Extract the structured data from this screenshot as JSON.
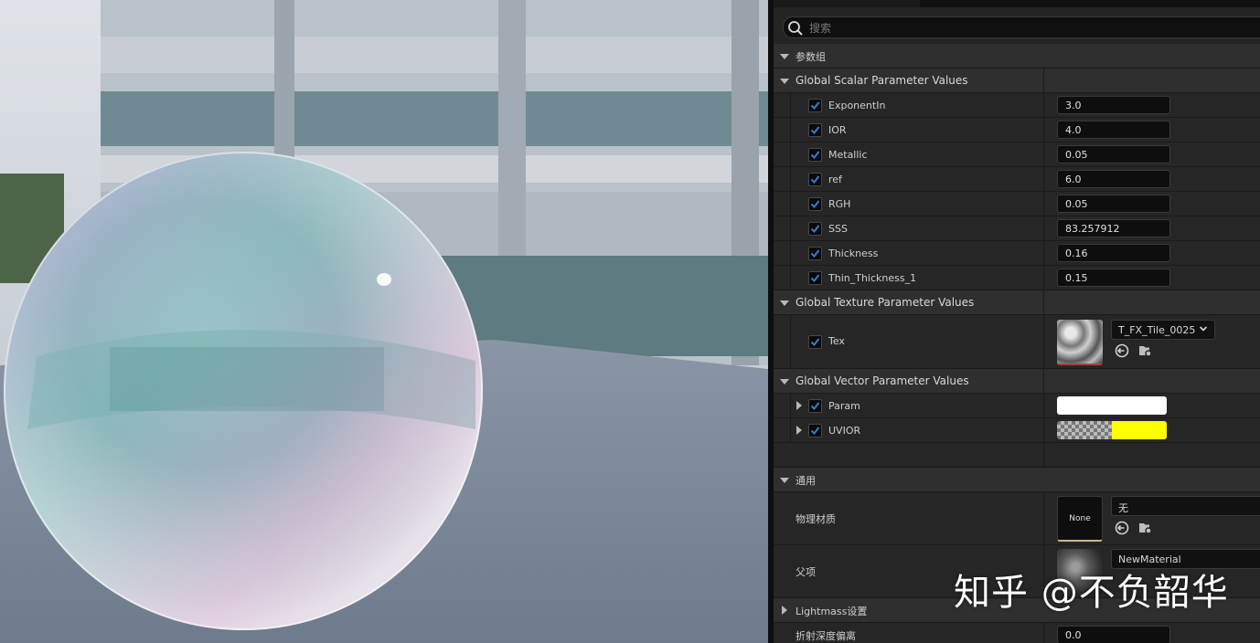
{
  "search": {
    "placeholder": "搜索"
  },
  "sections": {
    "params_group": "参数组",
    "scalar": "Global Scalar Parameter Values",
    "texture": "Global Texture Parameter Values",
    "vector": "Global Vector Parameter Values",
    "general": "通用",
    "lightmass": "Lightmass设置"
  },
  "scalar_params": [
    {
      "name": "ExponentIn",
      "value": "3.0"
    },
    {
      "name": "IOR",
      "value": "4.0"
    },
    {
      "name": "Metallic",
      "value": "0.05"
    },
    {
      "name": "ref",
      "value": "6.0"
    },
    {
      "name": "RGH",
      "value": "0.05"
    },
    {
      "name": "SSS",
      "value": "83.257912"
    },
    {
      "name": "Thickness",
      "value": "0.16"
    },
    {
      "name": "Thin_Thickness_1",
      "value": "0.15"
    }
  ],
  "texture_params": [
    {
      "name": "Tex",
      "asset": "T_FX_Tile_0025"
    }
  ],
  "vector_params": [
    {
      "name": "Param",
      "color": "#ffffff"
    },
    {
      "name": "UVIOR",
      "color": "#ffff00"
    }
  ],
  "general": {
    "phys_material_label": "物理材质",
    "phys_material_thumb": "None",
    "phys_material_value": "无",
    "parent_label": "父项",
    "parent_value": "NewMaterial",
    "refraction_label": "折射深度偏离",
    "refraction_value": "0.0"
  },
  "watermark": "知乎 @不负韶华",
  "colors": {
    "accent_check": "#2f7fd6",
    "panel_bg": "#242424",
    "category_bg": "#2f2f2f"
  },
  "icons": [
    "search-icon",
    "checkbox-check-icon",
    "chevron-down-icon",
    "use-asset-icon",
    "browse-asset-icon",
    "expand-arrow-icon"
  ]
}
